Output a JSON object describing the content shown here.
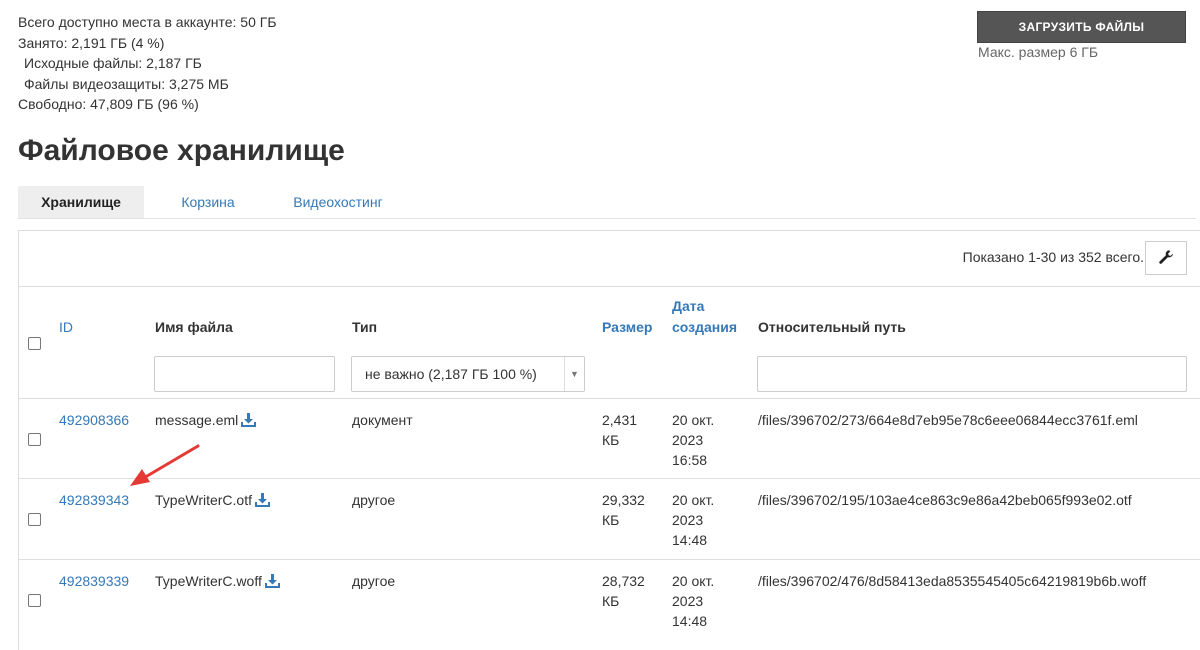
{
  "storage": {
    "total": "Всего доступно места в аккаунте: 50 ГБ",
    "used": "Занято: 2,191 ГБ (4 %)",
    "source_files": "Исходные файлы: 2,187 ГБ",
    "video_protection": "Файлы видеозащиты: 3,275 МБ",
    "free": "Свободно: 47,809 ГБ (96 %)"
  },
  "upload": {
    "button_label": "ЗАГРУЗИТЬ ФАЙЛЫ",
    "max_size_note": "Макс. размер 6 ГБ"
  },
  "page_title": "Файловое хранилище",
  "tabs": [
    {
      "label": "Хранилище",
      "active": true
    },
    {
      "label": "Корзина",
      "active": false
    },
    {
      "label": "Видеохостинг",
      "active": false
    }
  ],
  "toolbar": {
    "shown_text": "Показано 1-30 из 352 всего.",
    "settings_icon": "wrench-icon"
  },
  "columns": {
    "id": "ID",
    "name": "Имя файла",
    "type": "Тип",
    "size": "Размер",
    "created_line1": "Дата",
    "created_line2": "создания",
    "path": "Относительный путь"
  },
  "filters": {
    "name_value": "",
    "type_selected": "не важно (2,187 ГБ 100 %)",
    "path_value": ""
  },
  "rows": [
    {
      "id": "492908366",
      "name": "message.eml",
      "type": "документ",
      "size_line1": "2,431",
      "size_line2": "КБ",
      "date_line1": "20 окт.",
      "date_line2": "2023",
      "date_line3": "16:58",
      "path": "/files/396702/273/664e8d7eb95e78c6eee06844ecc3761f.eml"
    },
    {
      "id": "492839343",
      "name": "TypeWriterC.otf",
      "type": "другое",
      "size_line1": "29,332",
      "size_line2": "КБ",
      "date_line1": "20 окт.",
      "date_line2": "2023",
      "date_line3": "14:48",
      "path": "/files/396702/195/103ae4ce863c9e86a42beb065f993e02.otf"
    },
    {
      "id": "492839339",
      "name": "TypeWriterC.woff",
      "type": "другое",
      "size_line1": "28,732",
      "size_line2": "КБ",
      "date_line1": "20 окт.",
      "date_line2": "2023",
      "date_line3": "14:48",
      "path": "/files/396702/476/8d58413eda8535545405c64219819b6b.woff"
    }
  ],
  "colors": {
    "link": "#3579b8",
    "button_bg": "#555555",
    "annotation_arrow": "#e53935"
  },
  "icons": {
    "download": "download-icon",
    "caret": "chevron-down-icon",
    "arrow": "arrow-annotation-icon"
  }
}
